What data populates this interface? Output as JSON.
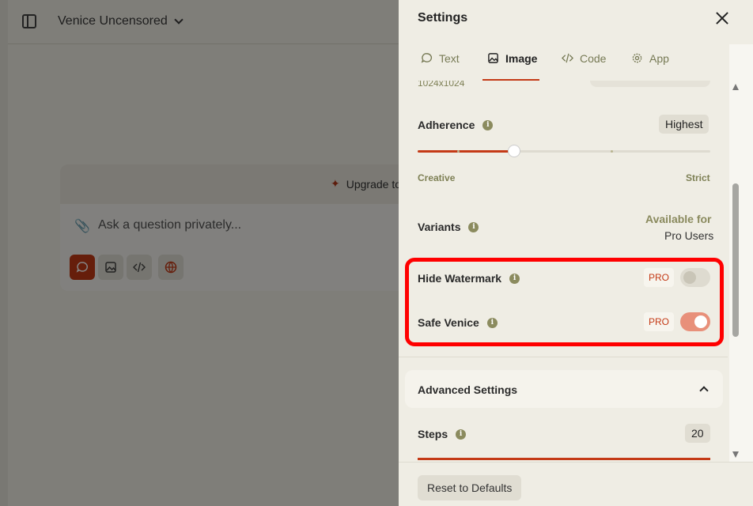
{
  "background": {
    "model_name": "Venice Uncensored",
    "upgrade_text": "Upgrade to",
    "composer_placeholder": "Ask a question privately..."
  },
  "settings": {
    "title": "Settings",
    "tabs": [
      {
        "label": "Text",
        "icon": "chat-bubble-icon"
      },
      {
        "label": "Image",
        "icon": "image-icon",
        "active": true
      },
      {
        "label": "Code",
        "icon": "code-icon"
      },
      {
        "label": "App",
        "icon": "gear-icon"
      }
    ],
    "resolution_label": "1024x1024",
    "adherence": {
      "label": "Adherence",
      "value": "Highest",
      "min_label": "Creative",
      "max_label": "Strict",
      "level": 0.33
    },
    "variants": {
      "label": "Variants",
      "avail_line1": "Available for",
      "avail_line2": "Pro Users"
    },
    "hide_watermark": {
      "label": "Hide Watermark",
      "pro": "PRO",
      "enabled": false
    },
    "safe_venice": {
      "label": "Safe Venice",
      "pro": "PRO",
      "enabled": true
    },
    "advanced": {
      "label": "Advanced Settings",
      "expanded": true
    },
    "steps": {
      "label": "Steps",
      "value": "20"
    },
    "reset_label": "Reset to Defaults"
  },
  "colors": {
    "accent": "#c43a16",
    "highlight": "#ff0000"
  }
}
